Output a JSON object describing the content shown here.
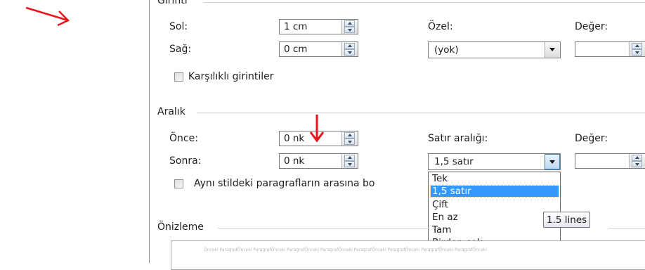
{
  "indentation": {
    "section_title": "Girinti",
    "left_label": "Sol:",
    "left_value": "1 cm",
    "right_label": "Sağ:",
    "right_value": "0 cm",
    "special_label": "Özel:",
    "special_value": "(yok)",
    "by_label": "Değer:",
    "by_value": "",
    "mirror_label": "Karşılıklı girintiler"
  },
  "spacing": {
    "section_title": "Aralık",
    "before_label": "Önce:",
    "before_value": "0 nk",
    "after_label": "Sonra:",
    "after_value": "0 nk",
    "line_spacing_label": "Satır aralığı:",
    "line_spacing_value": "1,5 satır",
    "at_label": "Değer:",
    "at_value": "",
    "dont_add_label": "Aynı stildeki paragrafların arasına bo",
    "options": [
      "Tek",
      "1,5 satır",
      "Çift",
      "En az",
      "Tam",
      "Birden çok"
    ],
    "selected_index": 1
  },
  "tooltip": "1.5 lines",
  "preview": {
    "section_title": "Önizleme",
    "sample_text": "Önceki ParagrafÖnceki ParagrafÖnceki ParagrafÖnceki ParagrafÖnceki ParagrafÖnceki ParagrafÖnceki ParagrafÖnceki ParagrafÖnceki"
  },
  "colors": {
    "annotation_arrow": "#e8141c",
    "selection": "#3399ff"
  }
}
